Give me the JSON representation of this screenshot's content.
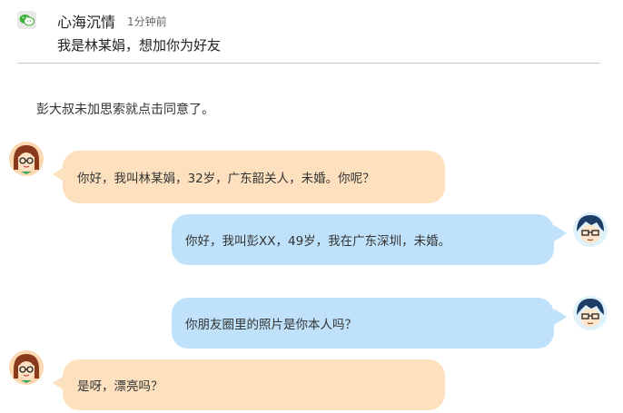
{
  "notification": {
    "app_icon": "wechat-icon",
    "sender": "心海沉情",
    "time": "1分钟前",
    "message": "我是林某娟，想加你为好友"
  },
  "narration": "彭大叔未加思索就点击同意了。",
  "chat": {
    "colors": {
      "left_bubble": "#fde1bf",
      "right_bubble": "#bfe2fa"
    },
    "messages": [
      {
        "side": "left",
        "avatar": "girl-avatar",
        "text": "你好，我叫林某娟，32岁，广东韶关人，未婚。你呢？"
      },
      {
        "side": "right",
        "avatar": "man-avatar",
        "text": "你好，我叫彭XX，49岁，我在广东深圳，未婚。"
      },
      {
        "side": "right",
        "avatar": "man-avatar",
        "text": "你朋友圈里的照片是你本人吗？"
      },
      {
        "side": "left",
        "avatar": "girl-avatar",
        "text": "是呀，漂亮吗？"
      }
    ]
  }
}
